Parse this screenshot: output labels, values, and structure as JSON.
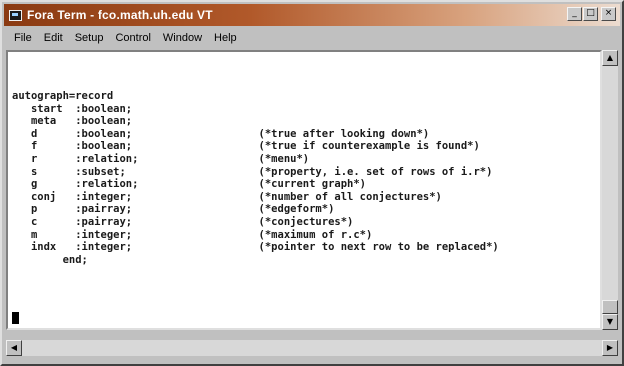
{
  "window": {
    "title": "Fora Term - fco.math.uh.edu VT",
    "buttons": {
      "minimize": "_",
      "maximize": "□",
      "close": "×"
    }
  },
  "menu": [
    "File",
    "Edit",
    "Setup",
    "Control",
    "Window",
    "Help"
  ],
  "terminal": {
    "lines": [
      "autograph=record",
      "   start  :boolean;",
      "   meta   :boolean;",
      "   d      :boolean;                    (*true after looking down*)",
      "   f      :boolean;                    (*true if counterexample is found*)",
      "   r      :relation;                   (*menu*)",
      "   s      :subset;                     (*property, i.e. set of rows of i.r*)",
      "   g      :relation;                   (*current graph*)",
      "   conj   :integer;                    (*number of all conjectures*)",
      "   p      :pairray;                    (*edgeform*)",
      "   c      :pairray;                    (*conjectures*)",
      "   m      :integer;                    (*maximum of r.c*)",
      "   indx   :integer;                    (*pointer to next row to be replaced*)",
      "        end;"
    ]
  },
  "scrollbars": {
    "up": "▲",
    "down": "▼",
    "left": "◀",
    "right": "▶"
  }
}
